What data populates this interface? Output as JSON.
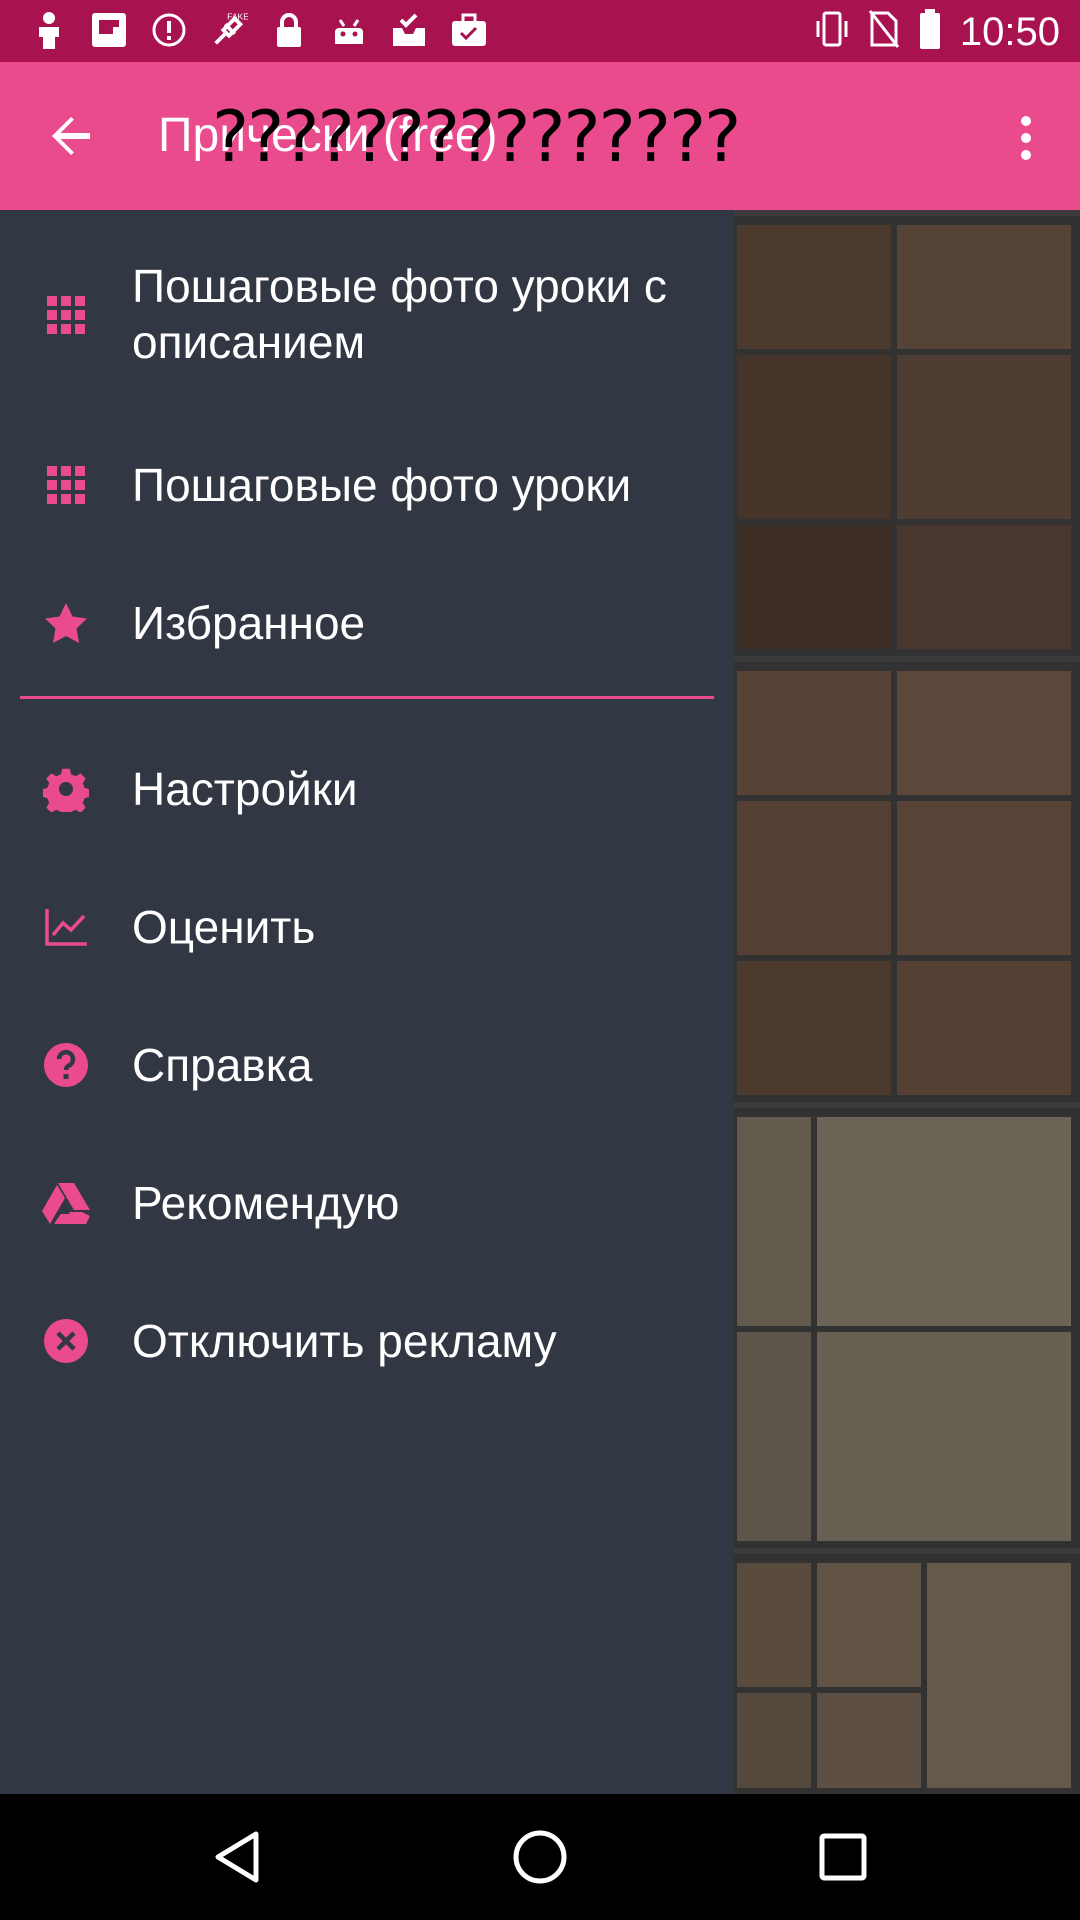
{
  "status_bar": {
    "time": "10:50",
    "icons": [
      "person-icon",
      "flipboard-icon",
      "alert-icon",
      "fake-gps-icon",
      "lock-icon",
      "android-icon",
      "inbox-check-icon",
      "briefcase-icon"
    ],
    "right_icons": [
      "vibrate-icon",
      "no-sim-icon",
      "battery-icon"
    ]
  },
  "app_bar": {
    "title": "Прически (free)",
    "title_glyphs": "???????????????",
    "back_icon": "arrow-back-icon",
    "more_icon": "more-vert-icon"
  },
  "drawer": {
    "items": [
      {
        "label": "Пошаговые фото уроки с описанием",
        "icon": "grid-icon"
      },
      {
        "label": "Пошаговые фото уроки",
        "icon": "grid-icon"
      },
      {
        "label": "Избранное",
        "icon": "star-icon"
      },
      {
        "label": "Настройки",
        "icon": "gear-icon"
      },
      {
        "label": "Оценить",
        "icon": "chart-line-icon"
      },
      {
        "label": "Справка",
        "icon": "help-circle-icon"
      },
      {
        "label": "Рекомендую",
        "icon": "drive-icon"
      },
      {
        "label": "Отключить рекламу",
        "icon": "close-circle-icon"
      }
    ]
  },
  "nav_bar": {
    "buttons": [
      "back-triangle-icon",
      "home-circle-icon",
      "recents-square-icon"
    ]
  },
  "colors": {
    "status_bar": "#a8124f",
    "app_bar": "#e94b8d",
    "accent": "#e94b8d",
    "drawer_bg": "#323744"
  }
}
